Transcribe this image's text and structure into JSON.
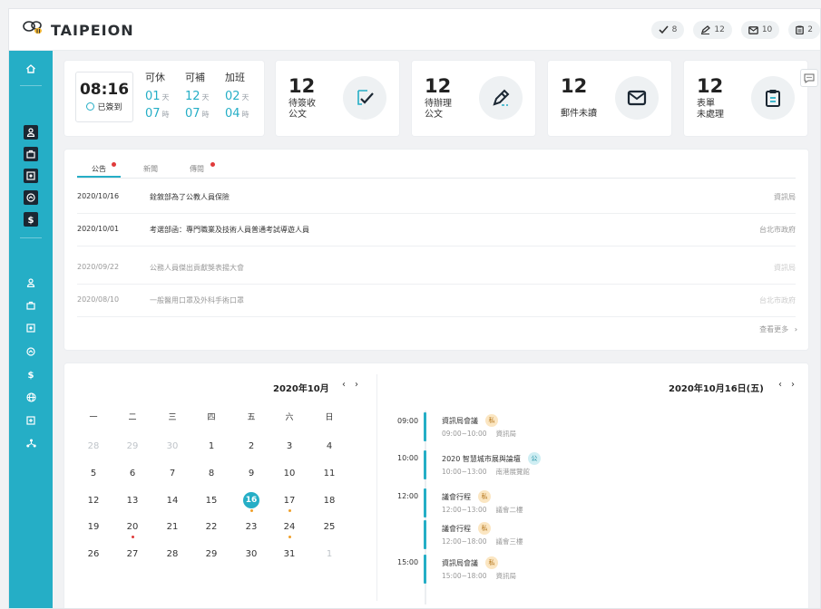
{
  "app": {
    "title": "TAIPEION"
  },
  "header_badges": [
    {
      "icon": "check-icon",
      "count": "8"
    },
    {
      "icon": "pen-icon",
      "count": "12"
    },
    {
      "icon": "mail-icon",
      "count": "10"
    },
    {
      "icon": "clipboard-icon",
      "count": "2"
    }
  ],
  "sidebar": {
    "items": [
      "home-icon",
      "user-icon",
      "briefcase-icon",
      "safe-icon",
      "gauge-icon",
      "dollar-icon",
      "user-icon",
      "briefcase-icon",
      "safe-icon",
      "gauge-icon",
      "dollar-icon",
      "globe-icon",
      "plus-square-icon",
      "network-icon"
    ]
  },
  "attendance": {
    "time": "08:16",
    "status": "已簽到",
    "columns": [
      {
        "label": "可休",
        "v1": "01",
        "u1": "天",
        "v2": "07",
        "u2": "時"
      },
      {
        "label": "可補",
        "v1": "12",
        "u1": "天",
        "v2": "07",
        "u2": "時"
      },
      {
        "label": "加班",
        "v1": "02",
        "u1": "天",
        "v2": "04",
        "u2": "時"
      }
    ]
  },
  "stats": [
    {
      "num": "12",
      "label1": "待簽收",
      "label2": "公文",
      "icon": "check-document-icon"
    },
    {
      "num": "12",
      "label1": "待辦理",
      "label2": "公文",
      "icon": "edit-document-icon"
    },
    {
      "num": "12",
      "label1": "郵件未讀",
      "label2": "",
      "icon": "mail-icon"
    },
    {
      "num": "12",
      "label1": "表單",
      "label2": "未處理",
      "icon": "clipboard-icon"
    }
  ],
  "announcements": {
    "tabs": [
      "公告",
      "新聞",
      "傳閱"
    ],
    "rows": [
      {
        "date": "2020/10/16",
        "title": "銓敘部為了公教人員保險",
        "source": "資訊局"
      },
      {
        "date": "2020/10/01",
        "title": "考選部函：專門職業及技術人員普通考試導遊人員",
        "source": "台北市政府"
      },
      {
        "date": "2020/09/22",
        "title": "公務人員傑出貢獻獎表揚大會",
        "source": "資訊局"
      },
      {
        "date": "2020/08/10",
        "title": "一般醫用口罩及外科手術口罩",
        "source": "台北市政府"
      }
    ],
    "more": "查看更多"
  },
  "calendar": {
    "title": "2020年10月",
    "weekdays": [
      "一",
      "二",
      "三",
      "四",
      "五",
      "六",
      "日"
    ],
    "weeks": [
      [
        "28",
        "29",
        "30",
        "1",
        "2",
        "3",
        "4"
      ],
      [
        "5",
        "6",
        "7",
        "8",
        "9",
        "10",
        "11"
      ],
      [
        "12",
        "13",
        "14",
        "15",
        "16",
        "17",
        "18"
      ],
      [
        "19",
        "20",
        "21",
        "22",
        "23",
        "24",
        "25"
      ],
      [
        "26",
        "27",
        "28",
        "29",
        "30",
        "31",
        "1"
      ]
    ],
    "today": "16"
  },
  "schedule": {
    "title": "2020年10月16日(五)",
    "events": [
      {
        "time": "09:00",
        "name": "資訊局會議",
        "tag": "私",
        "range": "09:00~10:00",
        "place": "資訊局"
      },
      {
        "time": "10:00",
        "name": "2020 智慧城市展與論壇",
        "tag": "公",
        "range": "10:00~13:00",
        "place": "南港展覽館"
      },
      {
        "time": "12:00",
        "name": "議會行程",
        "tag": "私",
        "range": "12:00~13:00",
        "place": "議會二樓"
      },
      {
        "time": "",
        "name": "議會行程",
        "tag": "私",
        "range": "12:00~18:00",
        "place": "議會三樓"
      },
      {
        "time": "15:00",
        "name": "資訊局會議",
        "tag": "私",
        "range": "15:00~18:00",
        "place": "資訊局"
      }
    ]
  },
  "colors": {
    "accent": "#25aec6",
    "sidebar": "#25aec6",
    "dot_orange": "#f0a02a",
    "dot_red": "#e03b3b"
  }
}
